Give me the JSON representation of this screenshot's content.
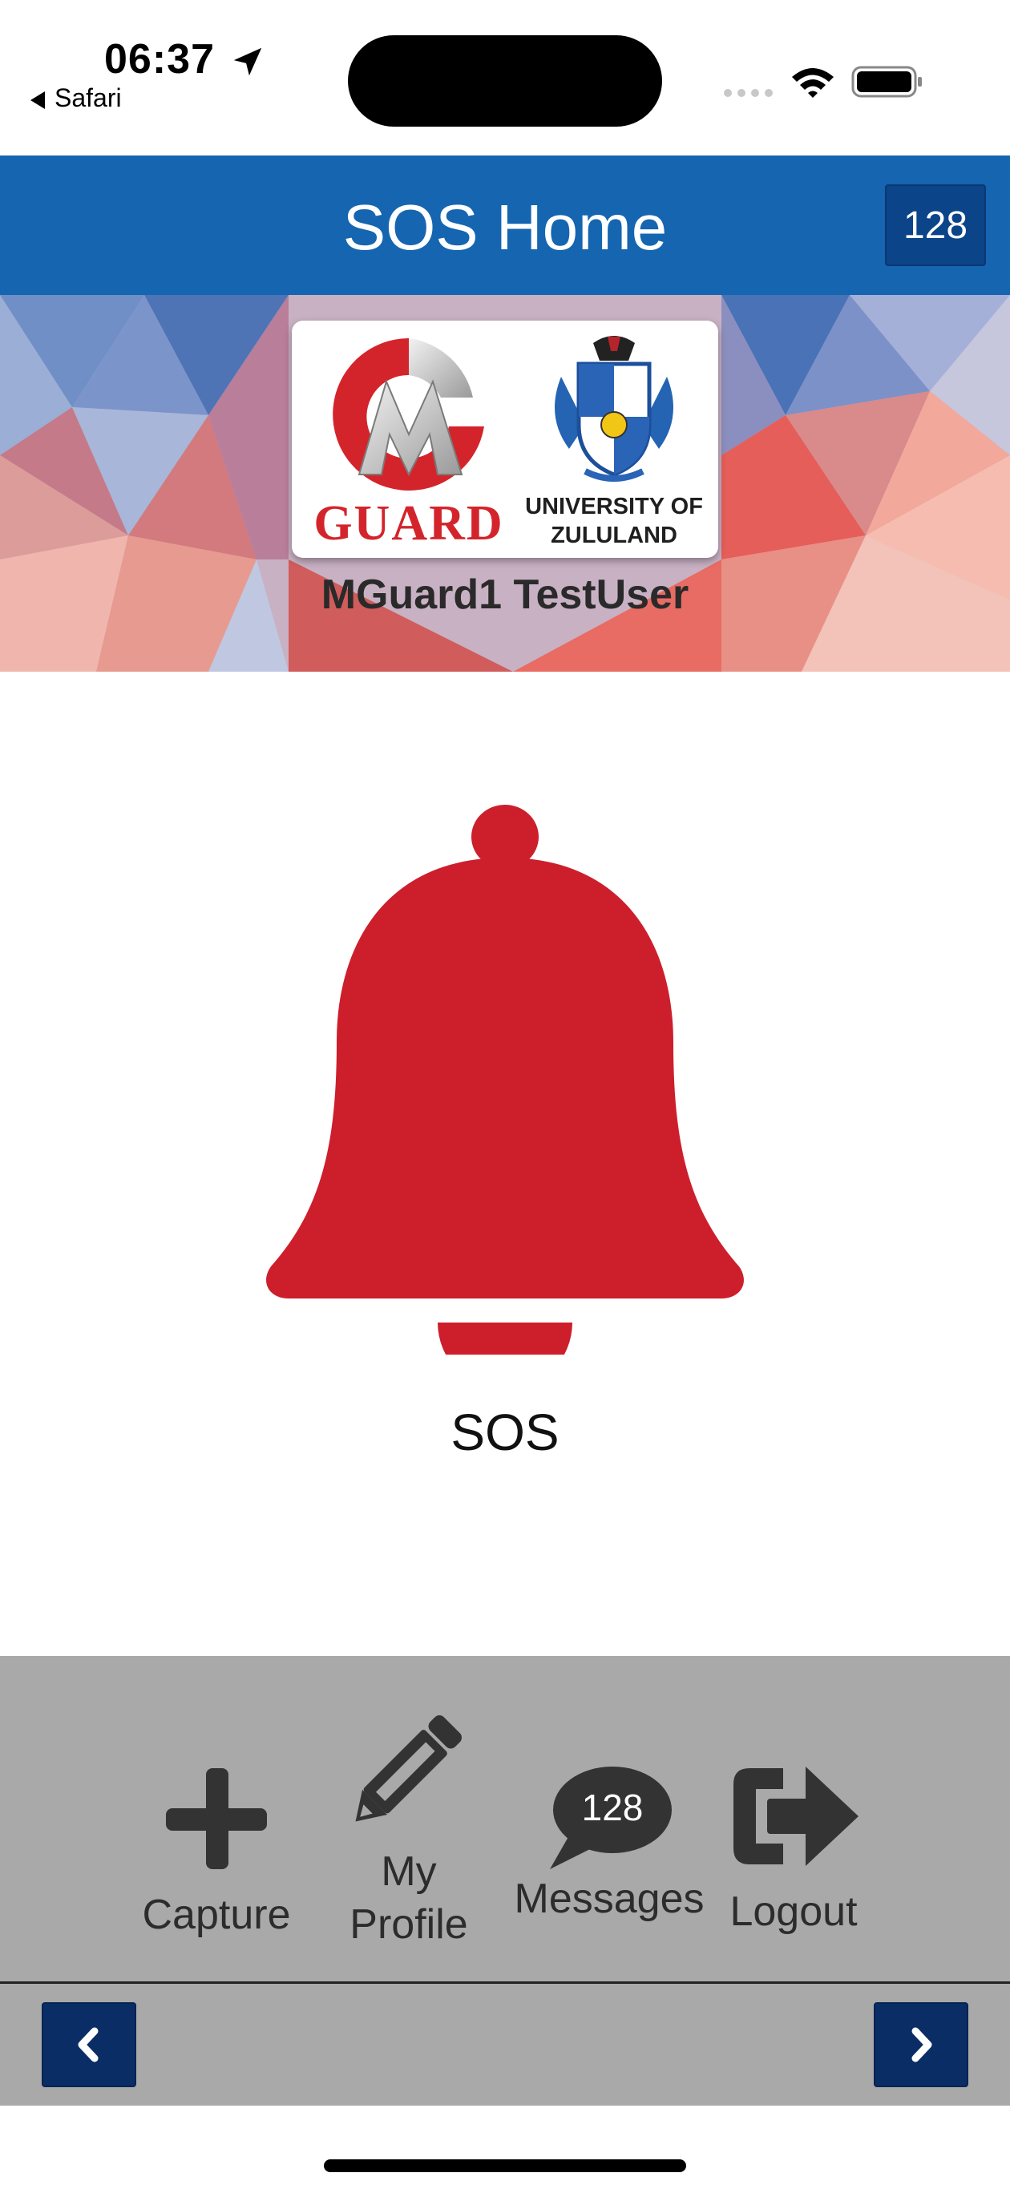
{
  "status_bar": {
    "time": "06:37",
    "back_app": "Safari",
    "icons": [
      "location-arrow-icon",
      "signal-icon",
      "wifi-icon",
      "battery-icon"
    ]
  },
  "header": {
    "title": "SOS Home",
    "badge": "128",
    "background_color": "#1565b0"
  },
  "banner": {
    "logo_text": "GUARD",
    "university_line1": "UNIVERSITY OF",
    "university_line2": "ZULULAND",
    "user_name": "MGuard1 TestUser"
  },
  "sos": {
    "label": "SOS",
    "icon": "bell-icon",
    "color": "#cd1e2c"
  },
  "bottom_nav": {
    "items": [
      {
        "label": "Capture",
        "icon": "plus-icon"
      },
      {
        "label_line1": "My",
        "label_line2": "Profile",
        "icon": "pencil-icon"
      },
      {
        "label": "Messages",
        "icon": "speech-bubble-icon",
        "badge": "128"
      },
      {
        "label": "Logout",
        "icon": "sign-out-icon"
      }
    ],
    "pager": {
      "prev_icon": "chevron-left-icon",
      "next_icon": "chevron-right-icon",
      "button_color": "#0b2d66"
    }
  }
}
